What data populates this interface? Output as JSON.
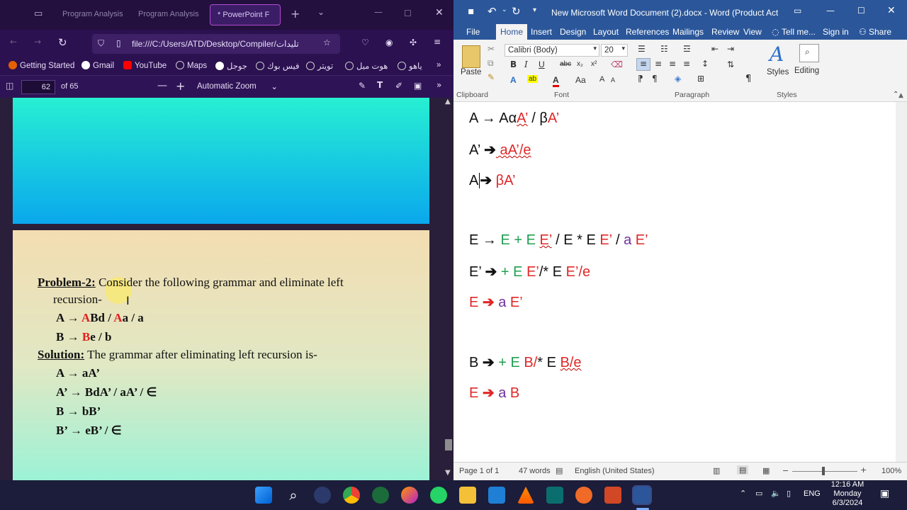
{
  "firefox": {
    "tabs": [
      {
        "label": "Program Analysis"
      },
      {
        "label": "Program Analysis"
      },
      {
        "label": "* PowerPoint F"
      }
    ],
    "url": "file:///C:/Users/ATD/Desktop/Compiler/تليدات",
    "bookmarks": [
      "Getting Started",
      "Gmail",
      "YouTube",
      "Maps",
      "جوجل",
      "فيس بوك",
      "تويتر",
      "هوت ميل",
      "ياهو"
    ],
    "pdf": {
      "page": "62",
      "of": "of 65",
      "zoom": "Automatic Zoom"
    },
    "slide": {
      "problem_label": "Problem-2:",
      "problem_text": " Consider the following grammar and eliminate left",
      "problem_text2": "recursion-",
      "g1_a": "A → ",
      "g1_b": "A",
      "g1_c": "Bd / ",
      "g1_d": "A",
      "g1_e": "a / a",
      "g2_a": "B → ",
      "g2_b": "B",
      "g2_c": "e / b",
      "solution_label": "Solution:",
      "solution_text": " The grammar after eliminating left recursion is-",
      "s1": "A → aA’",
      "s2": "A’ → BdA’ / aA’ / ∈",
      "s3": "B → bB’",
      "s4": "B’ → eB’ / ∈"
    }
  },
  "word": {
    "title": "New Microsoft Word Document (2).docx - Word (Product Acti...",
    "tabs": [
      "File",
      "Home",
      "Insert",
      "Design",
      "Layout",
      "References",
      "Mailings",
      "Review",
      "View",
      "Tell me...",
      "Sign in",
      "Share"
    ],
    "font": "Calibri (Body)",
    "size": "20",
    "groups": [
      "Clipboard",
      "Font",
      "Paragraph",
      "Styles"
    ],
    "paste": "Paste",
    "styles": "Styles",
    "editing": "Editing",
    "doc": {
      "l1": {
        "a": "A → Aα",
        "b": "A’",
        "c": " / β",
        "d": "A’"
      },
      "l2": {
        "a": "A’ ",
        "arrow": "➔",
        "b": " aA’/e"
      },
      "l3": {
        "a": "A",
        "arrow": "➔",
        "b": " βA’"
      },
      "l4": {
        "a": "E → ",
        "b": "E + E ",
        "c": "E’",
        "d": " / E * E ",
        "e": "E’",
        "f": " / ",
        "g": "a",
        "h": " E’"
      },
      "l5": {
        "a": "E’ ",
        "arrow": "➔",
        "b": " + E ",
        "c": "E’",
        "d": "/* E ",
        "e": "E’/e"
      },
      "l6": {
        "a": "E ",
        "arrow": "➔",
        "b": " a ",
        "c": "E’"
      },
      "l7": {
        "a": "B ",
        "arrow": "➔",
        "b": " + E ",
        "c": "B/",
        "d": "* E ",
        "e": "B/e"
      },
      "l8": {
        "a": "E ",
        "arrow": "➔",
        "b": " a ",
        "c": "B"
      }
    },
    "status": {
      "page": "Page 1 of 1",
      "words": "47 words",
      "lang": "English (United States)",
      "zoom": "100%"
    }
  },
  "taskbar": {
    "lang": "ENG",
    "time": "12:16 AM",
    "day": "Monday",
    "date": "6/3/2024"
  }
}
